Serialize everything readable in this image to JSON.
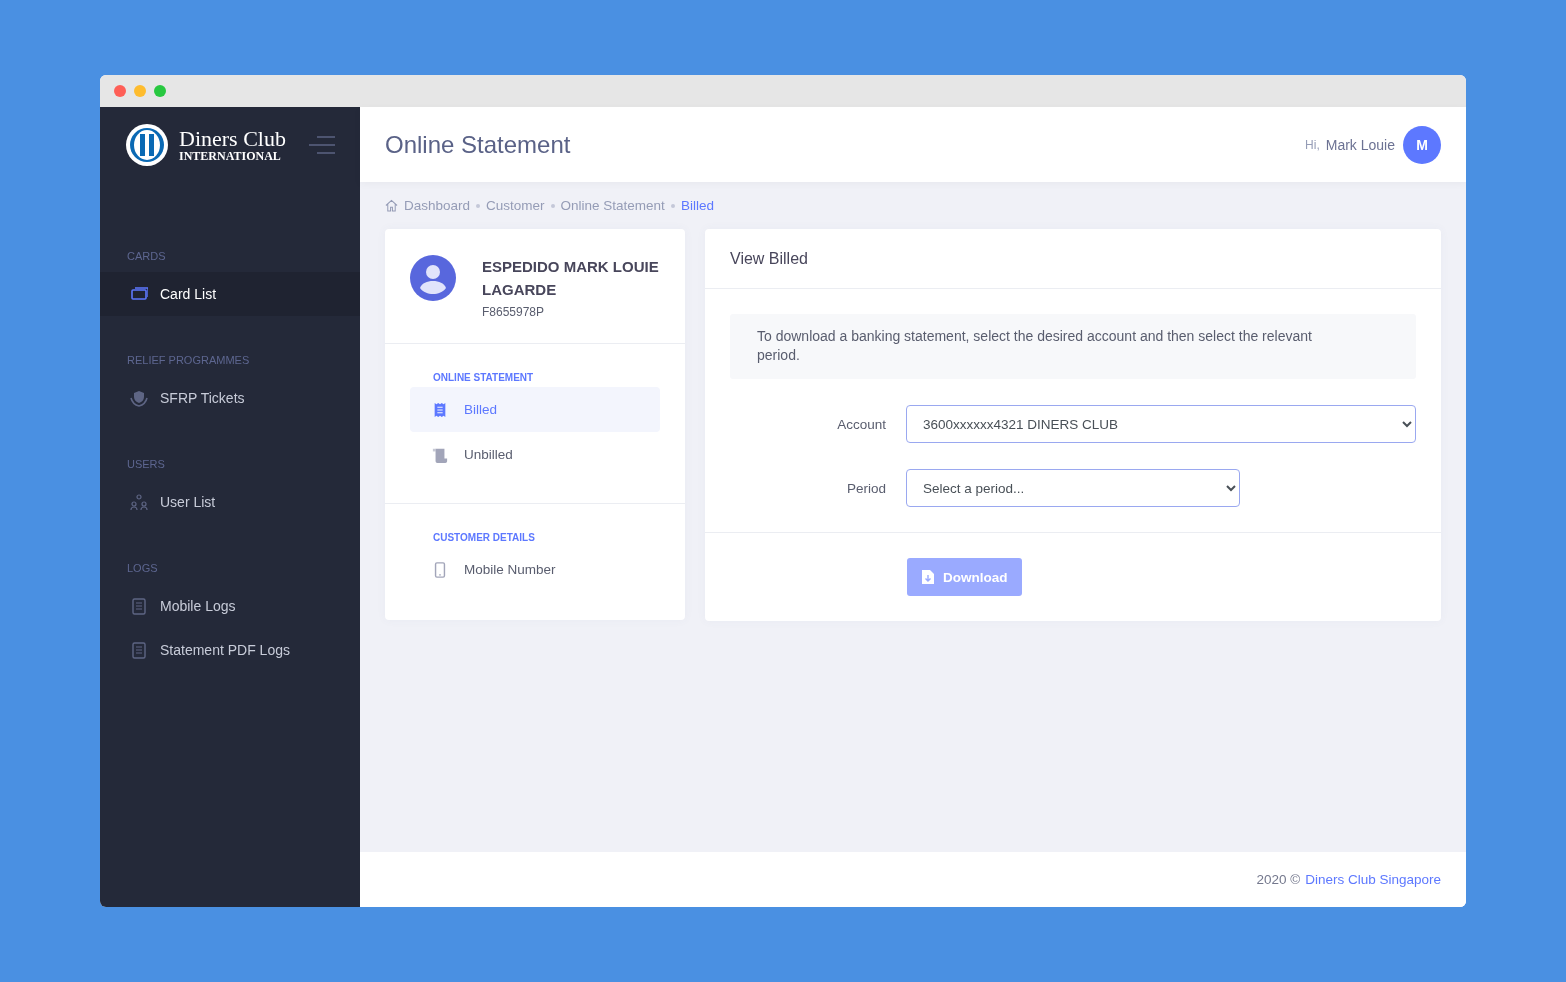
{
  "sidebar": {
    "logo": {
      "name": "Diners Club",
      "subtitle": "INTERNATIONAL"
    },
    "sections": [
      {
        "title": "CARDS",
        "items": [
          {
            "label": "Card List",
            "kind": "cards",
            "selected": true
          }
        ]
      },
      {
        "title": "RELIEF PROGRAMMES",
        "items": [
          {
            "label": "SFRP Tickets",
            "kind": "hands",
            "selected": false
          }
        ]
      },
      {
        "title": "USERS",
        "items": [
          {
            "label": "User List",
            "kind": "users",
            "selected": false
          }
        ]
      },
      {
        "title": "LOGS",
        "items": [
          {
            "label": "Mobile Logs",
            "kind": "doc",
            "selected": false
          },
          {
            "label": "Statement PDF Logs",
            "kind": "doc",
            "selected": false
          }
        ]
      }
    ]
  },
  "header": {
    "title": "Online Statement",
    "greeting": "Hi,",
    "user_name": "Mark Louie",
    "avatar_initial": "M"
  },
  "breadcrumb": [
    {
      "label": "Dashboard",
      "current": false
    },
    {
      "label": "Customer",
      "current": false
    },
    {
      "label": "Online Statement",
      "current": false
    },
    {
      "label": "Billed",
      "current": true
    }
  ],
  "customer": {
    "name": "ESPEDIDO MARK LOUIE LAGARDE",
    "id": "F8655978P",
    "menus": [
      {
        "title": "ONLINE STATEMENT",
        "items": [
          {
            "label": "Billed",
            "kind": "receipt",
            "selected": true
          },
          {
            "label": "Unbilled",
            "kind": "scroll",
            "selected": false
          }
        ]
      },
      {
        "title": "CUSTOMER DETAILS",
        "items": [
          {
            "label": "Mobile Number",
            "kind": "phone",
            "selected": false
          }
        ]
      }
    ]
  },
  "panel": {
    "title": "View Billed",
    "info": "To download a banking statement, select the desired account and then select the relevant period.",
    "fields": [
      {
        "label": "Account",
        "value": "3600xxxxxx4321  DINERS CLUB"
      },
      {
        "label": "Period",
        "value": "Select a period..."
      }
    ],
    "button": {
      "label": "Download",
      "disabled": true
    }
  },
  "footer": {
    "year": "2020 ©",
    "link": "Diners Club Singapore"
  }
}
